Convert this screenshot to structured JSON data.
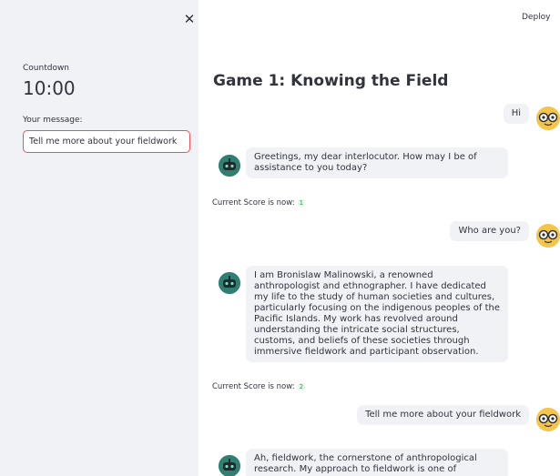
{
  "sidebar": {
    "countdown_label": "Countdown",
    "countdown_value": "10:00",
    "message_label": "Your message:",
    "message_value": "Tell me more about your fieldwork"
  },
  "header": {
    "deploy_label": "Deploy"
  },
  "main": {
    "title": "Game 1: Knowing the Field",
    "messages": [
      {
        "role": "user",
        "text": "Hi"
      },
      {
        "role": "assistant",
        "text": "Greetings, my dear interlocutor. How may I be of assistance to you today?"
      },
      {
        "role": "score",
        "label": "Current Score is now:",
        "value": "1"
      },
      {
        "role": "user",
        "text": "Who are you?"
      },
      {
        "role": "assistant",
        "text": "I am Bronislaw Malinowski, a renowned anthropologist and ethnographer. I have dedicated my life to the study of human societies and cultures, particularly focusing on the indigenous peoples of the Pacific Islands. My work has revolved around understanding the intricate social structures, customs, and beliefs of these societies through immersive fieldwork and participant observation."
      },
      {
        "role": "score",
        "label": "Current Score is now:",
        "value": "2"
      },
      {
        "role": "user",
        "text": "Tell me more about your fieldwork"
      },
      {
        "role": "assistant",
        "text": "Ah, fieldwork, the cornerstone of anthropological research. My approach to fieldwork is one of"
      }
    ]
  },
  "colors": {
    "sidebar_bg": "#f0f2f6",
    "input_focus_border": "#ff4b4b",
    "bubble_bg": "#f0f2f6",
    "score_badge": "#21a159",
    "user_avatar": "#f5c54a",
    "bot_avatar": "#2f7f72"
  },
  "icons": {
    "close": "close-icon",
    "user_avatar": "nerd-face-icon",
    "bot_avatar": "robot-icon"
  }
}
